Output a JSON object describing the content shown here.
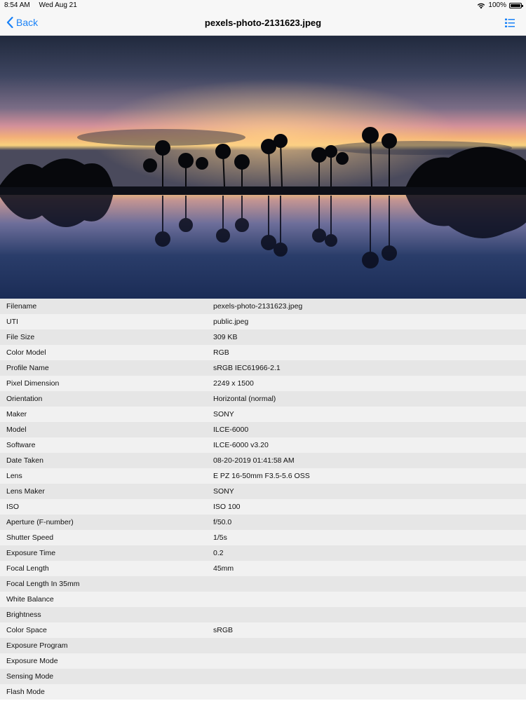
{
  "status": {
    "time": "8:54 AM",
    "date": "Wed Aug 21",
    "battery": "100%"
  },
  "nav": {
    "back_label": "Back",
    "title": "pexels-photo-2131623.jpeg"
  },
  "photo": {
    "description_icon": "palm-sunset-photo"
  },
  "metadata": [
    {
      "key": "Filename",
      "value": "pexels-photo-2131623.jpeg"
    },
    {
      "key": "UTI",
      "value": "public.jpeg"
    },
    {
      "key": "File Size",
      "value": "309 KB"
    },
    {
      "key": "Color Model",
      "value": "RGB"
    },
    {
      "key": "Profile Name",
      "value": "sRGB IEC61966-2.1"
    },
    {
      "key": "Pixel Dimension",
      "value": "2249 x 1500"
    },
    {
      "key": "Orientation",
      "value": "Horizontal (normal)"
    },
    {
      "key": "Maker",
      "value": "SONY"
    },
    {
      "key": "Model",
      "value": "ILCE-6000"
    },
    {
      "key": "Software",
      "value": "ILCE-6000 v3.20"
    },
    {
      "key": "Date Taken",
      "value": "08-20-2019 01:41:58 AM"
    },
    {
      "key": "Lens",
      "value": "E PZ 16-50mm F3.5-5.6 OSS"
    },
    {
      "key": "Lens Maker",
      "value": "SONY"
    },
    {
      "key": "ISO",
      "value": "ISO 100"
    },
    {
      "key": "Aperture (F-number)",
      "value": "f/50.0"
    },
    {
      "key": "Shutter Speed",
      "value": "1/5s"
    },
    {
      "key": "Exposure Time",
      "value": "0.2"
    },
    {
      "key": "Focal Length",
      "value": "45mm"
    },
    {
      "key": "Focal Length In 35mm",
      "value": ""
    },
    {
      "key": "White Balance",
      "value": ""
    },
    {
      "key": "Brightness",
      "value": ""
    },
    {
      "key": "Color Space",
      "value": "sRGB"
    },
    {
      "key": "Exposure Program",
      "value": ""
    },
    {
      "key": "Exposure Mode",
      "value": ""
    },
    {
      "key": "Sensing Mode",
      "value": ""
    },
    {
      "key": "Flash Mode",
      "value": ""
    }
  ]
}
